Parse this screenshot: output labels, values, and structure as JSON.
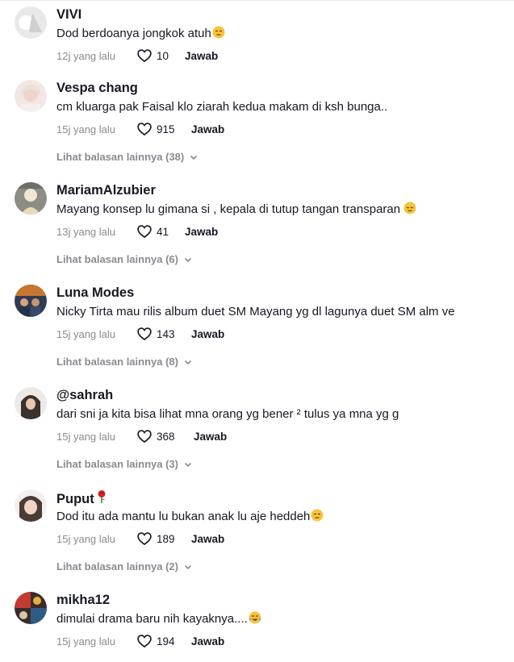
{
  "like_label": "",
  "comments": [
    {
      "username": "VIVI",
      "text": "Dod berdoanya jongkok atuh",
      "emoji": "unamused-face",
      "time": "12j yang lalu",
      "likes": "10",
      "reply": "Jawab",
      "more": ""
    },
    {
      "username": "Vespa chang",
      "text": "cm kluarga pak Faisal klo ziarah kedua makam di ksh bunga..",
      "emoji": "",
      "time": "15j yang lalu",
      "likes": "915",
      "reply": "Jawab",
      "more": "Lihat balasan lainnya (38)"
    },
    {
      "username": "MariamAlzubier",
      "text": "Mayang konsep lu gimana si , kepala di tutup tangan transparan",
      "emoji": "relieved-face",
      "time": "13j yang lalu",
      "likes": "41",
      "reply": "Jawab",
      "more": "Lihat balasan lainnya (6)"
    },
    {
      "username": "Luna Modes",
      "text": "Nicky Tirta mau rilis album duet SM Mayang yg dl lagunya duet SM alm ve",
      "emoji": "",
      "time": "15j yang lalu",
      "likes": "143",
      "reply": "Jawab",
      "more": "Lihat balasan lainnya (8)"
    },
    {
      "username": "@sahrah",
      "text": "dari sni ja kita bisa lihat mna orang yg bener ² tulus ya mna yg g",
      "emoji": "",
      "time": "15j yang lalu",
      "likes": "368",
      "reply": "Jawab",
      "more": "Lihat balasan lainnya (3)"
    },
    {
      "username": "Puput",
      "text": "Dod itu ada mantu lu bukan anak lu aje heddeh",
      "emoji": "unamused-face",
      "time": "15j yang lalu",
      "likes": "189",
      "reply": "Jawab",
      "more": "Lihat balasan lainnya (2)"
    },
    {
      "username": "mikha12",
      "text": "dimulai drama baru nih kayaknya....",
      "emoji": "tears-of-joy-face",
      "time": "15j yang lalu",
      "likes": "194",
      "reply": "Jawab",
      "more": ""
    }
  ],
  "username_icons": {
    "Puput": "rose-icon"
  },
  "colors": {
    "text": "#161823",
    "muted": "#8a8b91",
    "emoji": "#f7c33a"
  }
}
